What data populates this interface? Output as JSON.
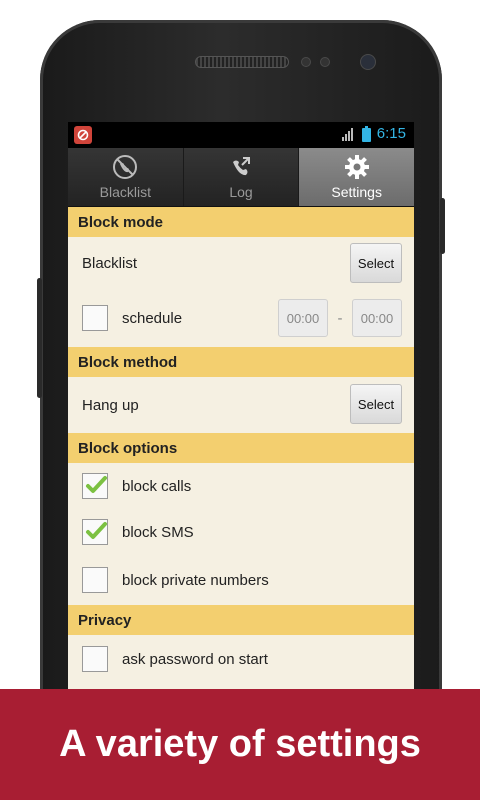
{
  "status": {
    "time": "6:15"
  },
  "tabs": [
    {
      "label": "Blacklist",
      "icon": "blocked-call-icon"
    },
    {
      "label": "Log",
      "icon": "call-log-icon"
    },
    {
      "label": "Settings",
      "icon": "gear-icon"
    }
  ],
  "block_mode": {
    "title": "Block mode",
    "mode_label": "Blacklist",
    "select_label": "Select",
    "schedule_label": "schedule",
    "time_from": "00:00",
    "time_to": "00:00",
    "time_separator": "-"
  },
  "block_method": {
    "title": "Block method",
    "method_label": "Hang up",
    "select_label": "Select"
  },
  "block_options": {
    "title": "Block options",
    "items": [
      {
        "label": "block calls",
        "checked": true
      },
      {
        "label": "block SMS",
        "checked": true
      },
      {
        "label": "block private numbers",
        "checked": false
      }
    ]
  },
  "privacy": {
    "title": "Privacy",
    "items": [
      {
        "label": "ask password on start",
        "checked": false
      }
    ]
  },
  "banner": {
    "text": "A variety of settings"
  },
  "colors": {
    "section_header": "#f3cf6f",
    "panel": "#f5f0e2",
    "banner": "#a81e33",
    "accent": "#33b5e5",
    "check": "#7cc142"
  }
}
